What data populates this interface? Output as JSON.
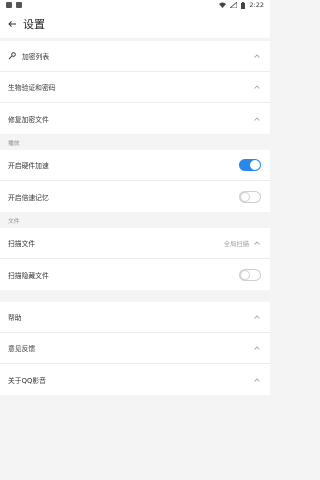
{
  "status_bar": {
    "time": "2:22"
  },
  "header": {
    "title": "设置"
  },
  "section1": {
    "items": [
      {
        "label": "加密列表"
      },
      {
        "label": "生物验证和密码"
      },
      {
        "label": "修复加密文件"
      }
    ]
  },
  "section_playback": {
    "title": "播放",
    "items": [
      {
        "label": "开启硬件加速",
        "toggle": true
      },
      {
        "label": "开启倍速记忆",
        "toggle": false
      }
    ]
  },
  "section_files": {
    "title": "文件",
    "items": [
      {
        "label": "扫描文件",
        "value": "全局扫描"
      },
      {
        "label": "扫描隐藏文件",
        "toggle": false
      }
    ]
  },
  "section_help": {
    "items": [
      {
        "label": "帮助"
      },
      {
        "label": "意见反馈"
      },
      {
        "label": "关于QQ影音"
      }
    ]
  },
  "colors": {
    "accent": "#2a88e9",
    "background": "#f4f4f4"
  }
}
